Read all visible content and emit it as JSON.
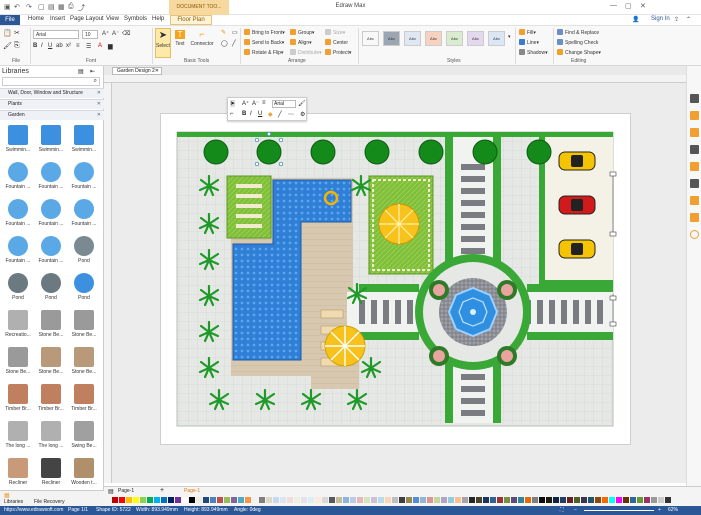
{
  "app": {
    "title": "Edraw Max",
    "doc_tools": "DOCUMENT TOO...",
    "signin": "Sign In"
  },
  "menu": {
    "file": "File",
    "items": [
      "Home",
      "Insert",
      "Page Layout",
      "View",
      "Symbols",
      "Help"
    ],
    "floor_plan": "Floor Plan"
  },
  "ribbon": {
    "font_name": "Arial",
    "font_size": "10",
    "groups": {
      "file": "File",
      "font": "Font",
      "basic_tools": "Basic Tools",
      "arrange": "Arrange",
      "styles": "Styles",
      "editing": "Editing"
    },
    "tools": {
      "select": "Select",
      "text": "Text",
      "connector": "Connector"
    },
    "arrange": [
      "Bring to Front",
      "Send to Back",
      "Rotate & Flip",
      "Group",
      "Align",
      "Distribute",
      "Size",
      "Center",
      "Protect"
    ],
    "style_label": "Abc",
    "style_colors": [
      "#ffffff",
      "#9aa6b2",
      "#dfe7f2",
      "#f7d2c0",
      "#d9eccf",
      "#e3d8ee",
      "#dbe7f5",
      "#cfd6de"
    ],
    "fill": "Fill",
    "line": "Line",
    "shadow": "Shadow",
    "editing": [
      "Find & Replace",
      "Spelling Check",
      "Change Shape"
    ]
  },
  "libraries": {
    "title": "Libraries",
    "categories": [
      "Wall, Door, Window and Structure",
      "Plants",
      "Garden"
    ],
    "items": [
      "Swimmin...",
      "Swimmin...",
      "Swimmin...",
      "Fountain ...",
      "Fountain ...",
      "Fountain ...",
      "Fountain ...",
      "Fountain ...",
      "Fountain ...",
      "Fountain ...",
      "Fountain ...",
      "Pond",
      "Pond",
      "Pond",
      "Pond",
      "Recreatio...",
      "Stone Be...",
      "Stone Be...",
      "Stone Be...",
      "Stone Be...",
      "Stone Be...",
      "Timber Br...",
      "Timber Br...",
      "Timber Br...",
      "The long ...",
      "The long ...",
      "Swing Be...",
      "Recliner",
      "Recliner",
      "Wooden t..."
    ],
    "tab_libraries": "Libraries",
    "tab_recovery": "File Recovery"
  },
  "document": {
    "tab": "Garden Design 2",
    "font": "Arial"
  },
  "pagebar": {
    "page": "Page-1",
    "active_page": "Page-1"
  },
  "palette": [
    "#c00000",
    "#ff0000",
    "#ffc000",
    "#ffff00",
    "#92d050",
    "#00b050",
    "#00b0f0",
    "#0070c0",
    "#002060",
    "#7030a0",
    "#ffffff",
    "#000000",
    "#eeece1",
    "#1f497d",
    "#4f81bd",
    "#c0504d",
    "#9bbb59",
    "#8064a2",
    "#4bacc6",
    "#f79646",
    "#f2f2f2",
    "#7f7f7f",
    "#ddd9c3",
    "#c6d9f0",
    "#dbe5f1",
    "#f2dcdb",
    "#ebf1dd",
    "#e5e0ec",
    "#dbeef3",
    "#fdeada",
    "#d8d8d8",
    "#595959",
    "#c4bd97",
    "#8db3e2",
    "#b8cce4",
    "#e5b9b7",
    "#d7e3bc",
    "#ccc1d9",
    "#b7dde8",
    "#fbd5b5",
    "#bfbfbf",
    "#3f3f3f",
    "#938953",
    "#548dd4",
    "#95b3d7",
    "#d99694",
    "#c3d69b",
    "#b2a2c7",
    "#92cddc",
    "#fac08f",
    "#a5a5a5",
    "#262626",
    "#494429",
    "#17365d",
    "#366092",
    "#953734",
    "#76923c",
    "#5f497a",
    "#31859b",
    "#e36c09",
    "#7f7f7f",
    "#0c0c0c",
    "#1d1b10",
    "#0f243e",
    "#244061",
    "#632423",
    "#4f6128",
    "#3f3151",
    "#205867",
    "#974806",
    "#ff6600",
    "#00ffff",
    "#ff00ff",
    "#663300",
    "#336699",
    "#669933",
    "#993366",
    "#999999",
    "#cccccc",
    "#333333"
  ],
  "status": {
    "url": "https://www.edrawsoft.com",
    "page": "Page 1/1",
    "shape": "Shape ID: 5722",
    "width": "Width: 893.949mm",
    "height": "Height: 893.949mm",
    "angle": "Angle: 0deg",
    "zoom": "62%"
  }
}
